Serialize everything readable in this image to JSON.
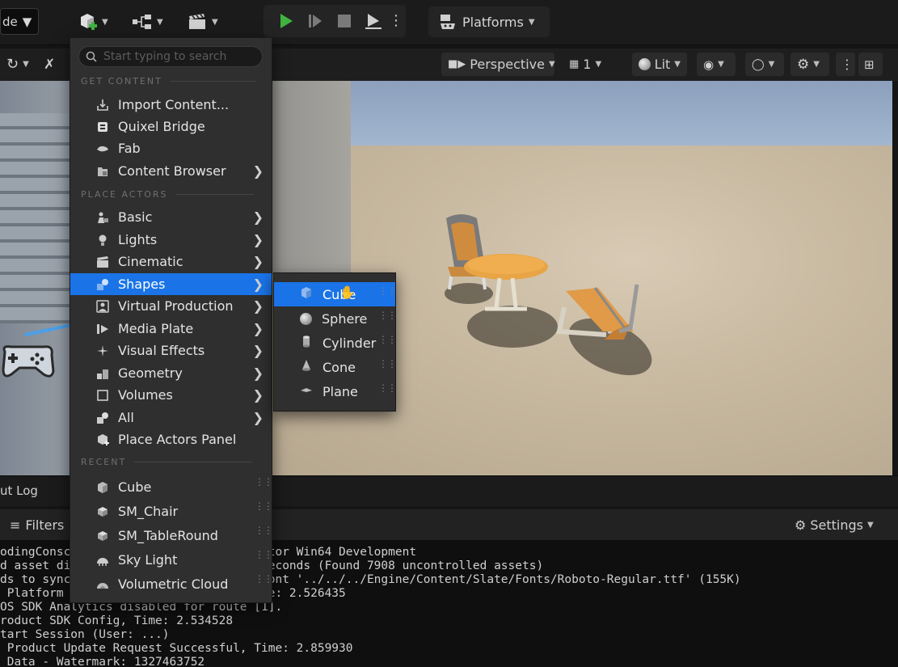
{
  "toolbar": {
    "mode_label": "de",
    "platforms_label": "Platforms"
  },
  "viewport_toolbar": {
    "perspective_label": "Perspective",
    "layout_count": "1",
    "lit_label": "Lit"
  },
  "add_menu": {
    "search_placeholder": "Start typing to search",
    "sections": {
      "get_content": "GET CONTENT",
      "place_actors": "PLACE ACTORS",
      "recent": "RECENT"
    },
    "get_content_items": [
      {
        "label": "Import Content...",
        "icon": "import-icon",
        "has_submenu": false
      },
      {
        "label": "Quixel Bridge",
        "icon": "bridge-icon",
        "has_submenu": false
      },
      {
        "label": "Fab",
        "icon": "fab-icon",
        "has_submenu": false
      },
      {
        "label": "Content Browser",
        "icon": "folder-icon",
        "has_submenu": true
      }
    ],
    "place_actor_items": [
      {
        "label": "Basic",
        "icon": "basic-icon",
        "has_submenu": true
      },
      {
        "label": "Lights",
        "icon": "light-icon",
        "has_submenu": true
      },
      {
        "label": "Cinematic",
        "icon": "clapper-icon",
        "has_submenu": true
      },
      {
        "label": "Shapes",
        "icon": "shapes-icon",
        "has_submenu": true,
        "active": true
      },
      {
        "label": "Virtual Production",
        "icon": "virtual-production-icon",
        "has_submenu": true
      },
      {
        "label": "Media Plate",
        "icon": "media-plate-icon",
        "has_submenu": true
      },
      {
        "label": "Visual Effects",
        "icon": "sparkle-icon",
        "has_submenu": true
      },
      {
        "label": "Geometry",
        "icon": "geometry-icon",
        "has_submenu": true
      },
      {
        "label": "Volumes",
        "icon": "volume-icon",
        "has_submenu": true
      },
      {
        "label": "All",
        "icon": "all-icon",
        "has_submenu": true
      },
      {
        "label": "Place Actors Panel",
        "icon": "place-actors-icon",
        "has_submenu": false
      }
    ],
    "recent_items": [
      {
        "label": "Cube",
        "icon": "cube-icon"
      },
      {
        "label": "SM_Chair",
        "icon": "static-mesh-icon"
      },
      {
        "label": "SM_TableRound",
        "icon": "static-mesh-icon"
      },
      {
        "label": "Sky Light",
        "icon": "sky-light-icon"
      },
      {
        "label": "Volumetric Cloud",
        "icon": "cloud-icon"
      }
    ]
  },
  "shapes_submenu": {
    "items": [
      {
        "label": "Cube",
        "icon": "cube-icon",
        "active": true
      },
      {
        "label": "Sphere",
        "icon": "sphere-icon"
      },
      {
        "label": "Cylinder",
        "icon": "cylinder-icon"
      },
      {
        "label": "Cone",
        "icon": "cone-icon"
      },
      {
        "label": "Plane",
        "icon": "plane-icon"
      }
    ]
  },
  "output_log": {
    "tab_label": "ut Log",
    "filters_label": "Filters",
    "settings_label": "Settings",
    "lines": [
      "odingConsc                         Editor Win64 Development",
      "d asset di                         3 seconds (Found 7908 uncontrolled assets)",
      "ds to sync                         d font '../../../Engine/Content/Slate/Fonts/Roboto-Regular.ttf' (155K)",
      " Platform                          Time: 2.526435",
      "OS SDK Analytics disabled for route [1].",
      "roduct SDK Config, Time: 2.534528",
      "tart Session (User: ...)",
      " Product Update Request Successful, Time: 2.859930",
      " Data - Watermark: 1327463752"
    ]
  },
  "colors": {
    "accent": "#1a74e8",
    "play_green": "#3fb43f",
    "menu_bg": "#2f2f2f"
  }
}
